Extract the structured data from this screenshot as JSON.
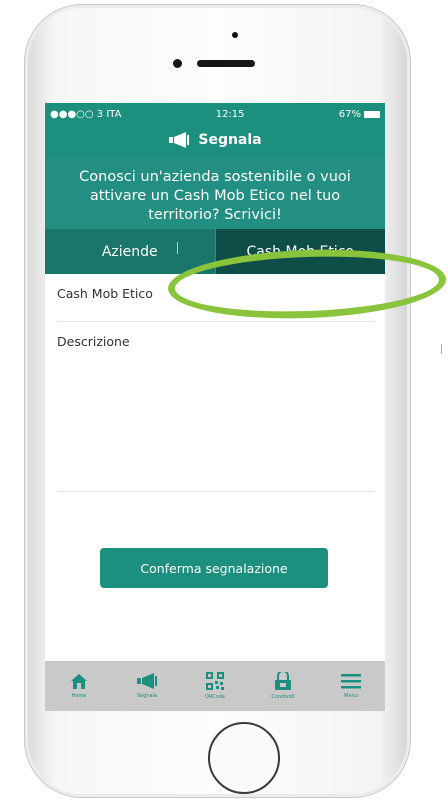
{
  "status_bar": {
    "carrier": "●●●○○ 3 ITA",
    "wifi_icon": "wifi-icon",
    "time": "12:15",
    "battery": "67%"
  },
  "nav": {
    "title": "Segnala",
    "icon": "megaphone-icon"
  },
  "banner": {
    "text": "Conosci un'azienda sostenibile o vuoi attivare un Cash Mob Etico nel tuo territorio? Scrivici!"
  },
  "tabs": {
    "aziende": "Aziende",
    "cash_mob": "Cash Mob Etico"
  },
  "form": {
    "name_label": "Cash Mob Etico",
    "description_label": "Descrizione",
    "submit": "Conferma segnalazione"
  },
  "tabbar": {
    "items": [
      {
        "label": "Home",
        "icon": "home-icon"
      },
      {
        "label": "Segnala",
        "icon": "megaphone-icon"
      },
      {
        "label": "QRCode",
        "icon": "qrcode-icon"
      },
      {
        "label": "Condividi",
        "icon": "share-icon"
      },
      {
        "label": "Menu",
        "icon": "menu-icon"
      }
    ]
  },
  "colors": {
    "primary": "#1c8f7e",
    "tab_active": "#0f4e48",
    "highlight": "#8ac33c"
  }
}
